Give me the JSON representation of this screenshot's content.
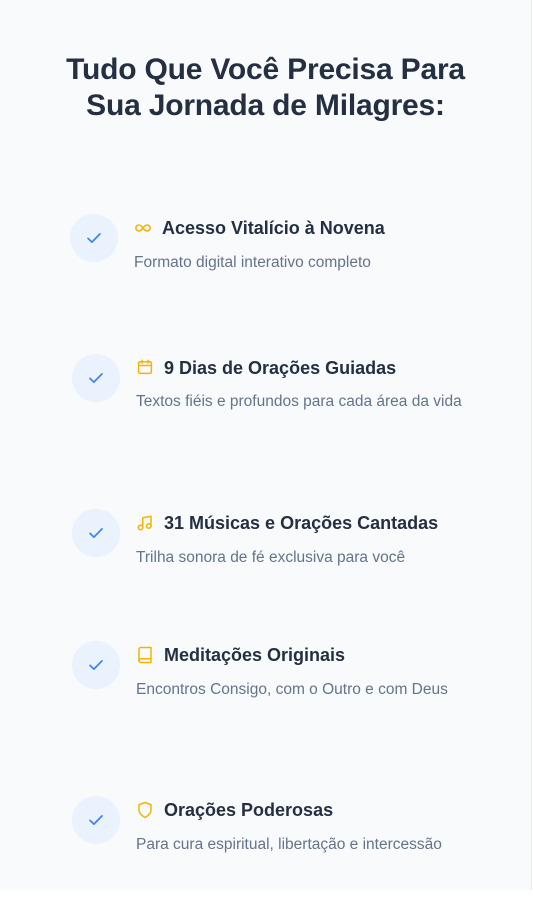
{
  "section": {
    "title_line1": "Tudo Que Você Precisa Para",
    "title_line2": "Sua Jornada de Milagres:"
  },
  "features": [
    {
      "icon": "infinity-icon",
      "title": "Acesso Vitalício à Novena",
      "description": "Formato digital interativo completo"
    },
    {
      "icon": "calendar-icon",
      "title": "9 Dias de Orações Guiadas",
      "description": "Textos fiéis e profundos para cada área da vida"
    },
    {
      "icon": "music-note-icon",
      "title": "31 Músicas e Orações Cantadas",
      "description": "Trilha sonora de fé exclusiva para você"
    },
    {
      "icon": "book-icon",
      "title": "Meditações Originais",
      "description": "Encontros Consigo, com o Outro e com Deus"
    },
    {
      "icon": "shield-icon",
      "title": "Orações Poderosas",
      "description": "Para cura espiritual, libertação e intercessão"
    }
  ],
  "colors": {
    "background": "#f8fafc",
    "heading": "#243041",
    "body_text": "#64748b",
    "check_circle": "#eaf2fd",
    "check_mark": "#3b82f6",
    "icon_accent": "#f5b400"
  }
}
